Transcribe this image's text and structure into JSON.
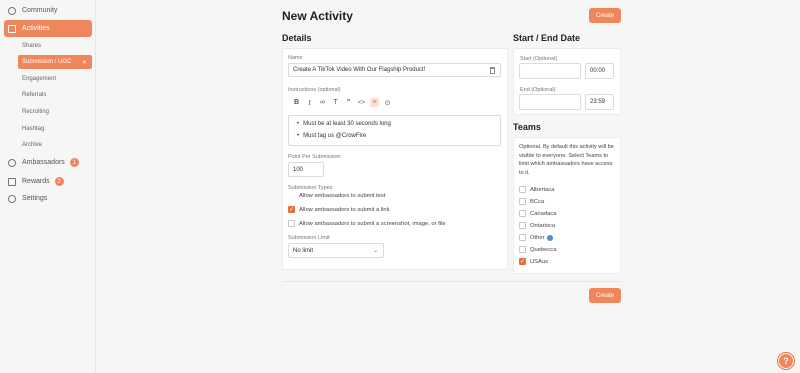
{
  "sidebar": {
    "community": "Community",
    "activities": "Activities",
    "sub": [
      "Shares",
      "Submission / UGC",
      "Engagement",
      "Referrals",
      "Recruiting",
      "Hashtag",
      "Archive"
    ],
    "sub_close": "✕",
    "ambassadors": "Ambassadors",
    "ambassadors_badge": "1",
    "rewards": "Rewards",
    "rewards_badge": "2",
    "settings": "Settings"
  },
  "header": {
    "title": "New Activity",
    "create_label": "Create"
  },
  "details": {
    "title": "Details",
    "name_label": "Name",
    "name_value": "Create A TikTok Video With Our Flagship Product!",
    "instructions_label": "Instructions (optional)",
    "bullets": [
      "Must be at least 30 seconds long",
      "Must tag us @CrowFire"
    ],
    "points_label": "Point Per Submission",
    "points_value": "100",
    "types_label": "Submission Types",
    "types": [
      {
        "label": "Allow ambassadors to submit text",
        "checked": false
      },
      {
        "label": "Allow ambassadors to submit a link",
        "checked": true
      },
      {
        "label": "Allow ambassadors to submit a screenshot, image, or file",
        "checked": false
      }
    ],
    "limit_label": "Submission Limit",
    "limit_value": "No limit"
  },
  "dates": {
    "title": "Start / End Date",
    "start_label": "Start (Optional)",
    "start_time": "00:00",
    "end_label": "End (Optional)",
    "end_time": "23:59"
  },
  "teams": {
    "title": "Teams",
    "description": "Optional. By default this activity will be visible to everyone. Select Teams to limit which ambassadors have access to it.",
    "items": [
      {
        "label": "Albertaca",
        "checked": false
      },
      {
        "label": "BCca",
        "checked": false
      },
      {
        "label": "Canadaca",
        "checked": false
      },
      {
        "label": "Ontarioca",
        "checked": false
      },
      {
        "label": "Other",
        "checked": false
      },
      {
        "label": "Quebecca",
        "checked": false
      },
      {
        "label": "USAus",
        "checked": true
      }
    ]
  },
  "footer": {
    "create_label": "Create"
  },
  "colors": {
    "accent": "#f0865c",
    "page_bg": "#f6f6f5"
  },
  "icons": [
    "community-icon",
    "activities-icon",
    "ambassadors-icon",
    "rewards-icon",
    "settings-icon",
    "trash-icon",
    "bold-icon",
    "italic-icon",
    "link-icon",
    "heading-icon",
    "quote-icon",
    "code-icon",
    "list-icon",
    "attachment-icon",
    "chevron-down-icon",
    "globe-icon",
    "help-icon"
  ]
}
